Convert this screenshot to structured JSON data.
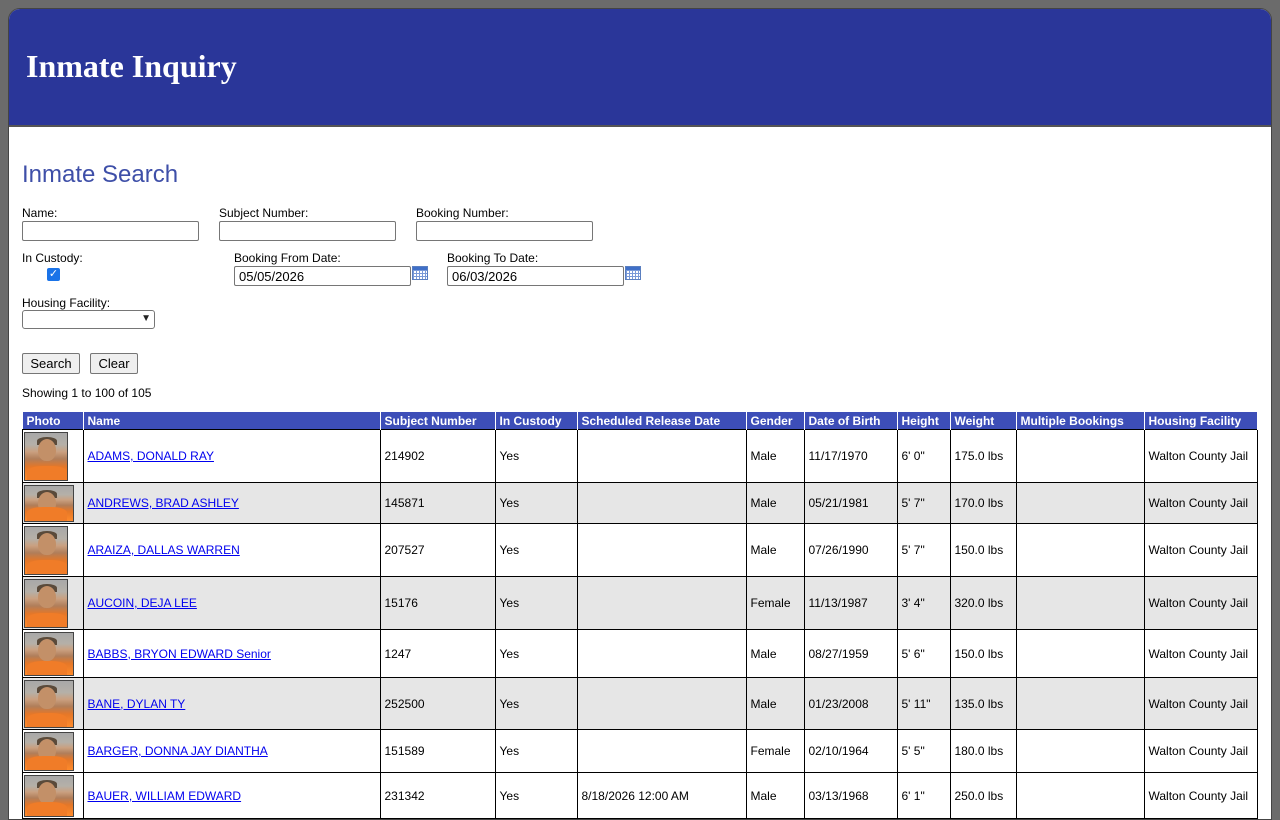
{
  "header": {
    "title": "Inmate Inquiry"
  },
  "search": {
    "title": "Inmate Search",
    "name_label": "Name:",
    "name_value": "",
    "subject_label": "Subject Number:",
    "subject_value": "",
    "booking_label": "Booking Number:",
    "booking_value": "",
    "in_custody_label": "In Custody:",
    "in_custody_checked": true,
    "from_label": "Booking From Date:",
    "from_value": "05/05/2026",
    "to_label": "Booking To Date:",
    "to_value": "06/03/2026",
    "housing_label": "Housing Facility:",
    "housing_value": "",
    "search_button": "Search",
    "clear_button": "Clear"
  },
  "results": {
    "showing": "Showing 1 to 100 of 105",
    "columns": [
      "Photo",
      "Name",
      "Subject Number",
      "In Custody",
      "Scheduled Release Date",
      "Gender",
      "Date of Birth",
      "Height",
      "Weight",
      "Multiple Bookings",
      "Housing Facility"
    ],
    "rows": [
      {
        "name": "ADAMS, DONALD RAY",
        "subject": "214902",
        "custody": "Yes",
        "release": "",
        "gender": "Male",
        "dob": "11/17/1970",
        "height": "6' 0\"",
        "weight": "175.0 lbs",
        "multiple": "",
        "facility": "Walton County Jail"
      },
      {
        "name": "ANDREWS, BRAD ASHLEY",
        "subject": "145871",
        "custody": "Yes",
        "release": "",
        "gender": "Male",
        "dob": "05/21/1981",
        "height": "5' 7\"",
        "weight": "170.0 lbs",
        "multiple": "",
        "facility": "Walton County Jail"
      },
      {
        "name": "ARAIZA, DALLAS WARREN",
        "subject": "207527",
        "custody": "Yes",
        "release": "",
        "gender": "Male",
        "dob": "07/26/1990",
        "height": "5' 7\"",
        "weight": "150.0 lbs",
        "multiple": "",
        "facility": "Walton County Jail"
      },
      {
        "name": "AUCOIN, DEJA LEE",
        "subject": "15176",
        "custody": "Yes",
        "release": "",
        "gender": "Female",
        "dob": "11/13/1987",
        "height": "3' 4\"",
        "weight": "320.0 lbs",
        "multiple": "",
        "facility": "Walton County Jail"
      },
      {
        "name": "BABBS, BRYON EDWARD Senior",
        "subject": "1247",
        "custody": "Yes",
        "release": "",
        "gender": "Male",
        "dob": "08/27/1959",
        "height": "5' 6\"",
        "weight": "150.0 lbs",
        "multiple": "",
        "facility": "Walton County Jail"
      },
      {
        "name": "BANE, DYLAN TY",
        "subject": "252500",
        "custody": "Yes",
        "release": "",
        "gender": "Male",
        "dob": "01/23/2008",
        "height": "5' 11\"",
        "weight": "135.0 lbs",
        "multiple": "",
        "facility": "Walton County Jail"
      },
      {
        "name": "BARGER, DONNA JAY DIANTHA",
        "subject": "151589",
        "custody": "Yes",
        "release": "",
        "gender": "Female",
        "dob": "02/10/1964",
        "height": "5' 5\"",
        "weight": "180.0 lbs",
        "multiple": "",
        "facility": "Walton County Jail"
      },
      {
        "name": "BAUER, WILLIAM EDWARD",
        "subject": "231342",
        "custody": "Yes",
        "release": "8/18/2026 12:00 AM",
        "gender": "Male",
        "dob": "03/13/1968",
        "height": "6' 1\"",
        "weight": "250.0 lbs",
        "multiple": "",
        "facility": "Walton County Jail"
      }
    ]
  }
}
